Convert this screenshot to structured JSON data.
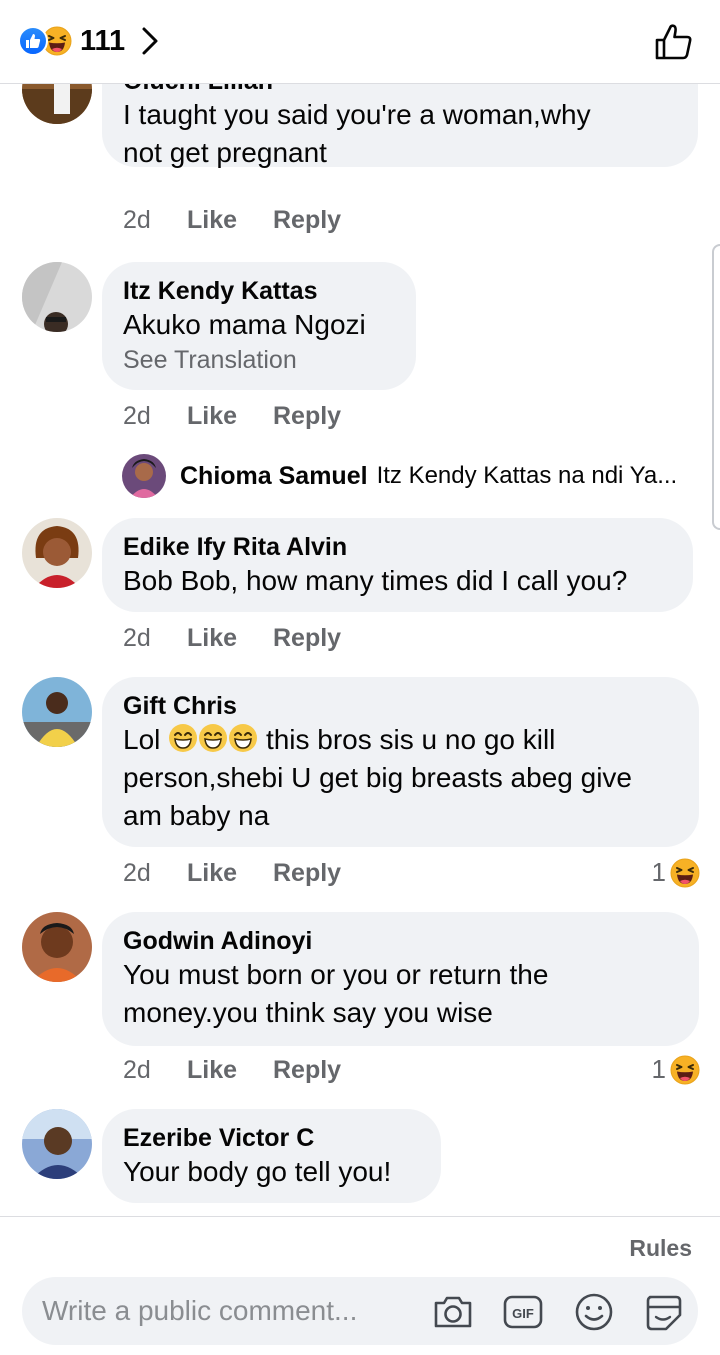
{
  "header": {
    "reaction_count": "111",
    "reaction_icons": [
      "like-icon",
      "haha-icon"
    ],
    "accent": "#0866ff"
  },
  "comments": [
    {
      "author": "Oluchi Lilian",
      "text_lines": [
        "I taught you said you're a woman,why",
        "not get pregnant"
      ],
      "time": "2d",
      "like": "Like",
      "reply": "Reply"
    },
    {
      "author": "Itz Kendy Kattas",
      "text_lines": [
        "Akuko mama Ngozi"
      ],
      "see_translation": "See Translation",
      "time": "2d",
      "like": "Like",
      "reply": "Reply",
      "reply_preview": {
        "author": "Chioma Samuel",
        "text": "Itz Kendy Kattas na ndi Ya..."
      }
    },
    {
      "author": "Edike Ify Rita Alvin",
      "text_lines": [
        "Bob Bob, how many times did I call you?"
      ],
      "time": "2d",
      "like": "Like",
      "reply": "Reply"
    },
    {
      "author": "Gift Chris",
      "text_lines": [
        "Lol",
        "this bros sis u no go kill",
        "person,shebi U get big breasts abeg give",
        "am baby na"
      ],
      "time": "2d",
      "like": "Like",
      "reply": "Reply",
      "reaction_count": "1"
    },
    {
      "author": "Godwin Adinoyi",
      "text_lines": [
        "You must born or you or return the",
        "money.you think say you wise"
      ],
      "time": "2d",
      "like": "Like",
      "reply": "Reply",
      "reaction_count": "1"
    },
    {
      "author": "Ezeribe Victor C",
      "text_lines": [
        "Your body go tell you!"
      ]
    }
  ],
  "footer": {
    "rules": "Rules",
    "placeholder": "Write a public comment..."
  }
}
